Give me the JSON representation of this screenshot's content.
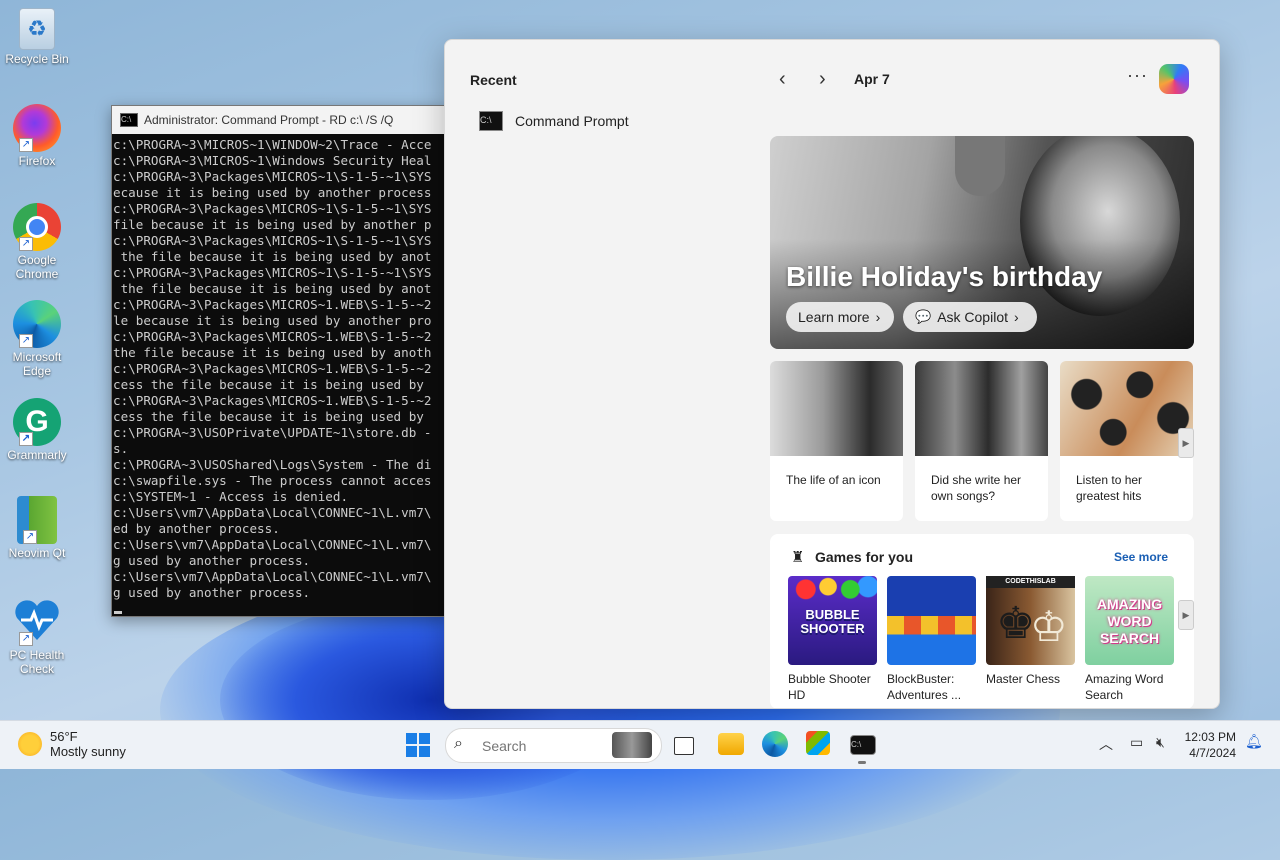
{
  "desktop": {
    "icons": [
      {
        "label": "Recycle Bin",
        "icon": "recycle-bin-icon"
      },
      {
        "label": "Firefox",
        "icon": "firefox-icon"
      },
      {
        "label": "Google Chrome",
        "icon": "chrome-icon"
      },
      {
        "label": "Microsoft Edge",
        "icon": "edge-icon"
      },
      {
        "label": "Grammarly",
        "icon": "grammarly-icon"
      },
      {
        "label": "Neovim Qt",
        "icon": "neovim-icon"
      },
      {
        "label": "PC Health Check",
        "icon": "health-check-icon"
      }
    ]
  },
  "cmd": {
    "title": "Administrator: Command Prompt - RD  c:\\ /S /Q",
    "lines": [
      "c:\\PROGRA~3\\MICROS~1\\WINDOW~2\\Trace - Acce",
      "c:\\PROGRA~3\\MICROS~1\\Windows Security Heal",
      "c:\\PROGRA~3\\Packages\\MICROS~1\\S-1-5-~1\\SYS",
      "ecause it is being used by another process",
      "c:\\PROGRA~3\\Packages\\MICROS~1\\S-1-5-~1\\SYS",
      "file because it is being used by another p",
      "c:\\PROGRA~3\\Packages\\MICROS~1\\S-1-5-~1\\SYS",
      " the file because it is being used by anot",
      "c:\\PROGRA~3\\Packages\\MICROS~1\\S-1-5-~1\\SYS",
      " the file because it is being used by anot",
      "c:\\PROGRA~3\\Packages\\MICROS~1.WEB\\S-1-5-~2",
      "le because it is being used by another pro",
      "c:\\PROGRA~3\\Packages\\MICROS~1.WEB\\S-1-5-~2",
      "the file because it is being used by anoth",
      "c:\\PROGRA~3\\Packages\\MICROS~1.WEB\\S-1-5-~2",
      "cess the file because it is being used by",
      "c:\\PROGRA~3\\Packages\\MICROS~1.WEB\\S-1-5-~2",
      "cess the file because it is being used by",
      "c:\\PROGRA~3\\USOPrivate\\UPDATE~1\\store.db -",
      "s.",
      "c:\\PROGRA~3\\USOShared\\Logs\\System - The di",
      "c:\\swapfile.sys - The process cannot acces",
      "c:\\SYSTEM~1 - Access is denied.",
      "c:\\Users\\vm7\\AppData\\Local\\CONNEC~1\\L.vm7\\",
      "ed by another process.",
      "c:\\Users\\vm7\\AppData\\Local\\CONNEC~1\\L.vm7\\",
      "g used by another process.",
      "c:\\Users\\vm7\\AppData\\Local\\CONNEC~1\\L.vm7\\",
      "g used by another process."
    ]
  },
  "widgets": {
    "recent_heading": "Recent",
    "recent_item": "Command Prompt",
    "date": "Apr 7",
    "more_label": "···",
    "hero": {
      "title": "Billie Holiday's birthday",
      "learn_more": "Learn more",
      "ask_copilot": "Ask Copilot"
    },
    "cards": [
      {
        "text": "The life of an icon"
      },
      {
        "text": "Did she write her own songs?"
      },
      {
        "text": "Listen to her greatest hits"
      }
    ],
    "games": {
      "heading": "Games for you",
      "see_more": "See more",
      "items": [
        {
          "name": "Bubble Shooter HD",
          "thumb": "BUBBLE SHOOTER"
        },
        {
          "name": "BlockBuster: Adventures ..."
        },
        {
          "name": "Master Chess",
          "thumb": "CODETHISLAB"
        },
        {
          "name": "Amazing Word Search",
          "thumb": "AMAZING WORD SEARCH"
        }
      ]
    }
  },
  "taskbar": {
    "weather_temp": "56°F",
    "weather_desc": "Mostly sunny",
    "search_placeholder": "Search",
    "time": "12:03 PM",
    "date": "4/7/2024"
  }
}
